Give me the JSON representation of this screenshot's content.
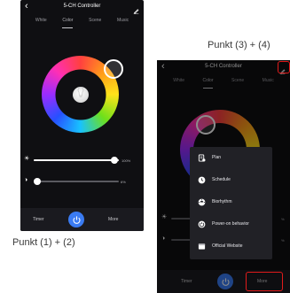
{
  "left_phone": {
    "title": "5-CH Controller",
    "tabs": [
      "White",
      "Color",
      "Scene",
      "Music"
    ],
    "active_tab": "Color",
    "brightness_pct": "100%",
    "saturation_pct": "6%",
    "brightness_level": 1.0,
    "saturation_level": 0.06,
    "bottom": {
      "timer": "Timer",
      "more": "More"
    }
  },
  "right_phone": {
    "title": "5-CH Controller",
    "tabs": [
      "White",
      "Color",
      "Scene",
      "Music"
    ],
    "menu": [
      {
        "label": "Plan",
        "icon": "plan-icon"
      },
      {
        "label": "Schedule",
        "icon": "clock-icon"
      },
      {
        "label": "Biorhythm",
        "icon": "biorhythm-icon"
      },
      {
        "label": "Power-on behavior",
        "icon": "power-on-icon"
      },
      {
        "label": "Official Website",
        "icon": "website-icon"
      }
    ],
    "pct_a": "%",
    "pct_b": "%",
    "bottom": {
      "timer": "Timer",
      "more": "More"
    }
  },
  "captions": {
    "left": "Punkt (1) + (2)",
    "right": "Punkt (3) + (4)"
  },
  "colors": {
    "accent": "#3a7bf2",
    "highlight": "#e11b1b",
    "background": "#0f0f12"
  }
}
